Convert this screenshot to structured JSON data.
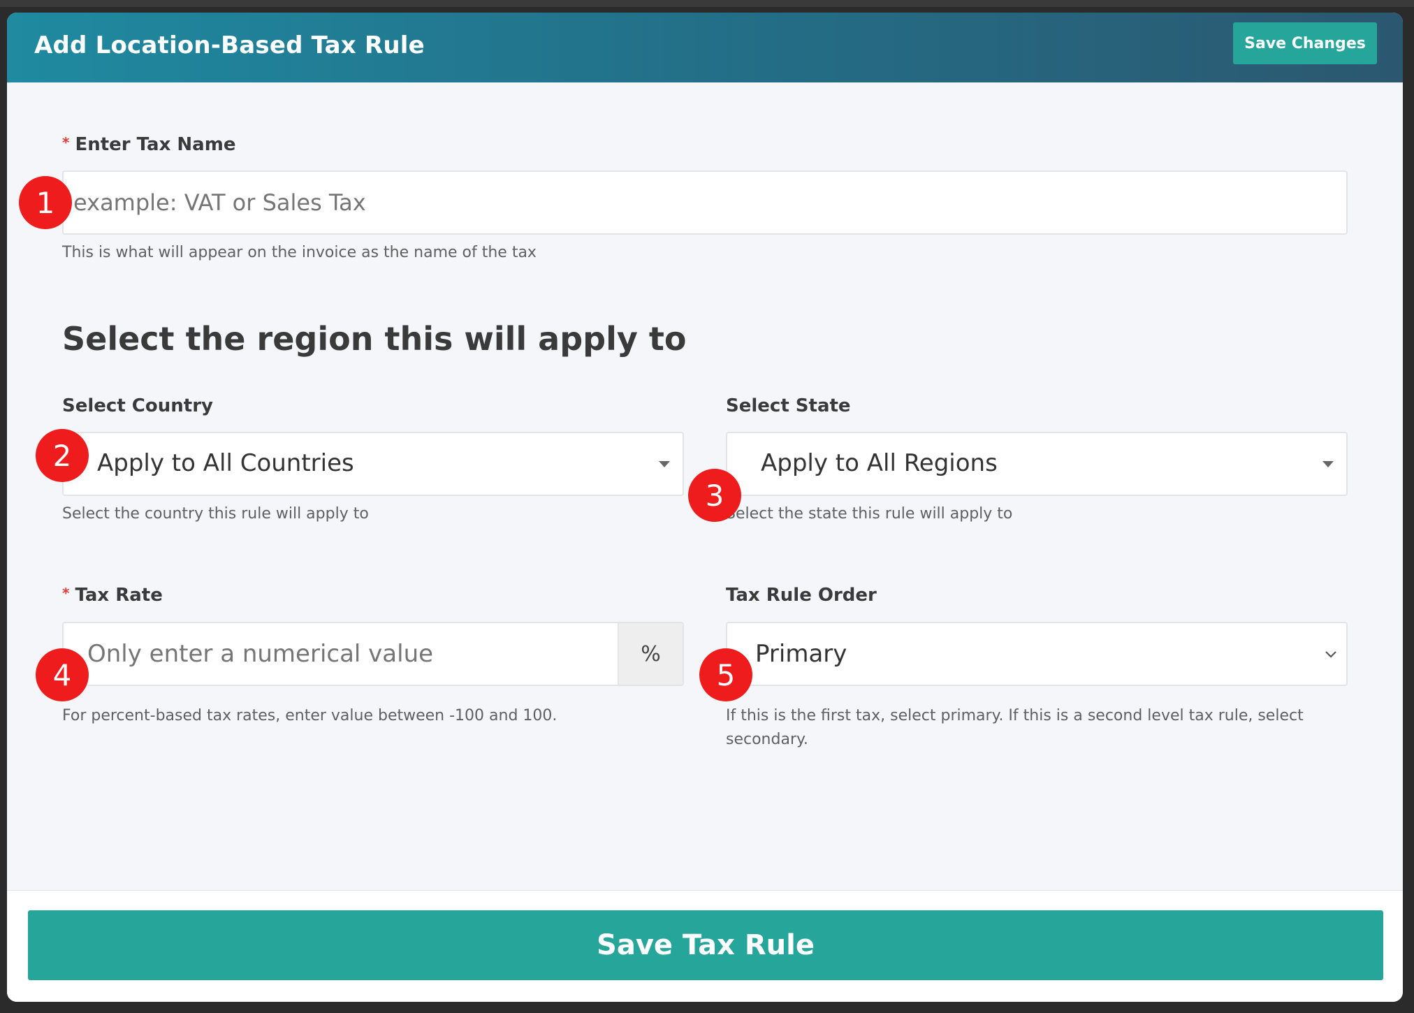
{
  "modal": {
    "title": "Add Location-Based Tax Rule",
    "save_changes_label": "Save Changes"
  },
  "tax_name": {
    "required_mark": "*",
    "label": "Enter Tax Name",
    "placeholder": "example: VAT or Sales Tax",
    "value": "",
    "help": "This is what will appear on the invoice as the name of the tax"
  },
  "region": {
    "heading": "Select the region this will apply to"
  },
  "country": {
    "label": "Select Country",
    "selected": "Apply to All Countries",
    "help": "Select the country this rule will apply to"
  },
  "state": {
    "label": "Select State",
    "selected": "Apply to All Regions",
    "help": "Select the state this rule will apply to"
  },
  "tax_rate": {
    "required_mark": "*",
    "label": "Tax Rate",
    "placeholder": "Only enter a numerical value",
    "value": "",
    "addon": "%",
    "help": "For percent-based tax rates, enter value between -100 and 100."
  },
  "rule_order": {
    "label": "Tax Rule Order",
    "selected": "Primary",
    "help": "If this is the first tax, select primary. If this is a second level tax rule, select secondary."
  },
  "annotations": [
    "1",
    "2",
    "3",
    "4",
    "5"
  ],
  "footer": {
    "save_rule_label": "Save Tax Rule"
  },
  "colors": {
    "header_start": "#1f8aa0",
    "header_end": "#2b5870",
    "primary_button": "#26a69a",
    "required": "#e53935",
    "annotation_badge": "#ee1c1c"
  },
  "icons": {
    "select_caret": "caret-down-icon",
    "order_chevron": "chevron-down-icon"
  }
}
